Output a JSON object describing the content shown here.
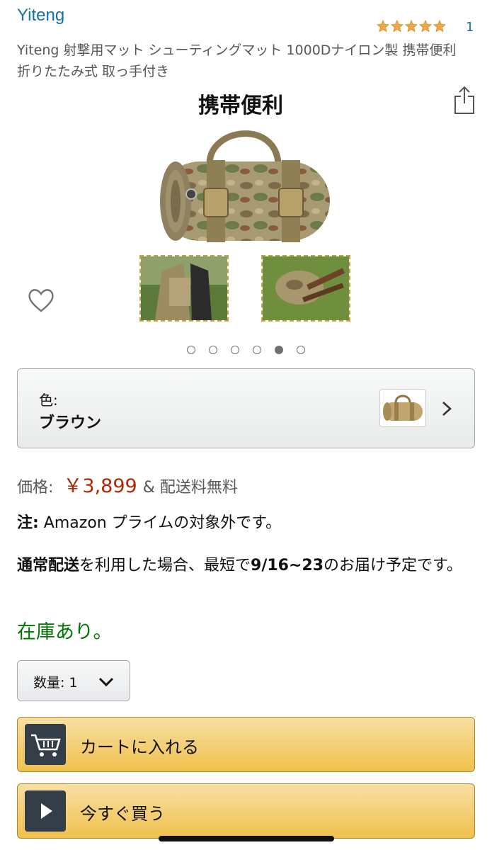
{
  "header": {
    "brand": "Yiteng",
    "rating_count": "1",
    "stars": 5,
    "title": "Yiteng 射撃用マット シューティングマット 1000Dナイロン製 携帯便利 折りたたみ式 取っ手付き"
  },
  "gallery": {
    "image_caption": "携帯便利",
    "dots_total": 6,
    "active_dot": 5,
    "icons": [
      "share-icon",
      "heart-icon"
    ]
  },
  "color": {
    "label": "色:",
    "value": "ブラウン",
    "icon": "chevron-right-icon"
  },
  "price": {
    "label": "価格:",
    "amount": "￥3,899",
    "shipping": "& 配送料無料"
  },
  "note": {
    "bold": "注:",
    "text": " Amazon プライムの対象外です。"
  },
  "delivery": {
    "part1": "通常配送",
    "part2": "を利用した場合、最短で",
    "part3": "9/16~23",
    "part4": "のお届け予定です。"
  },
  "stock": "在庫あり。",
  "quantity": {
    "label": "数量: 1",
    "icon": "chevron-down-icon"
  },
  "buttons": {
    "cart": "カートに入れる",
    "buy": "今すぐ買う"
  },
  "colors": {
    "link": "#1a6fa3",
    "price": "#b12704",
    "stock": "#007600",
    "button": "#f0c14b",
    "star": "#f3a847"
  }
}
